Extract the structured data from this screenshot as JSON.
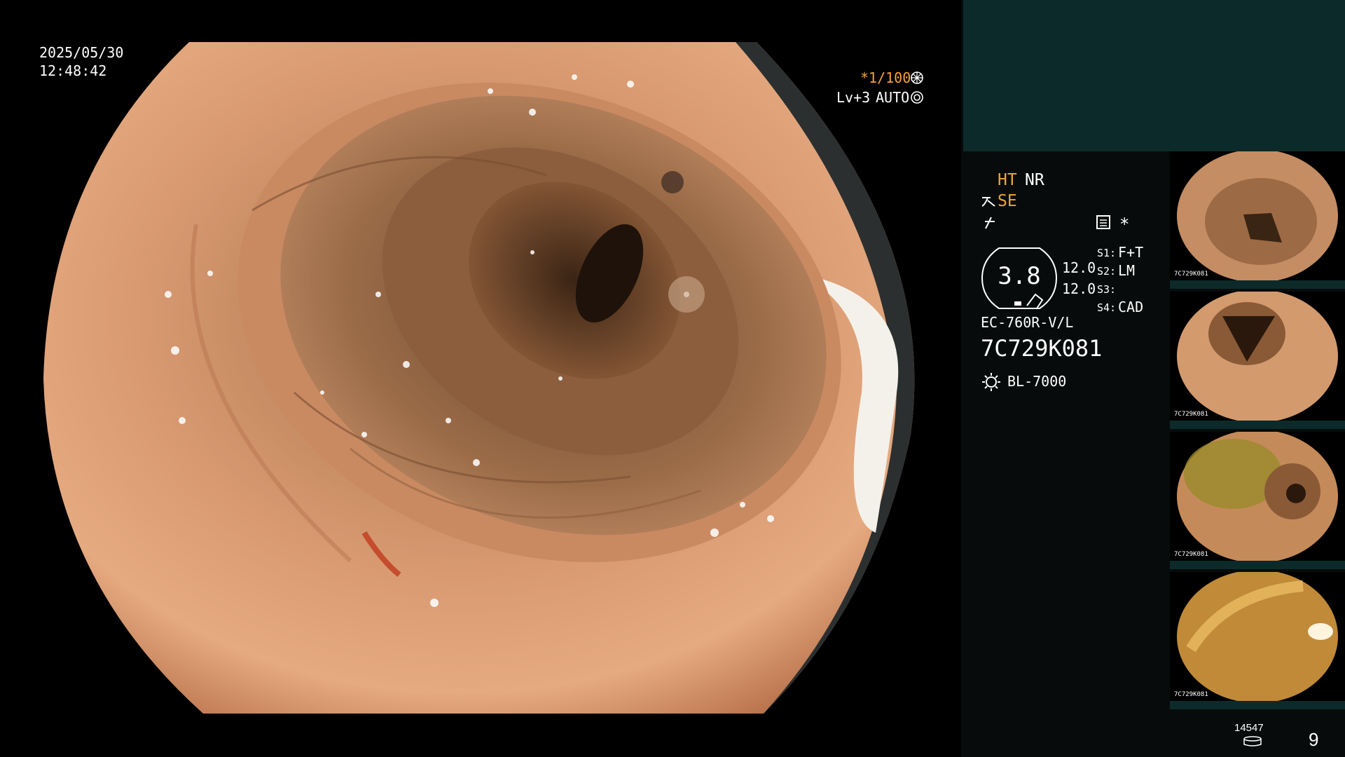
{
  "osd": {
    "date": "2025/05/30",
    "time": "12:48:42",
    "shutter_prefix": "*",
    "shutter": "1/100",
    "iris_level": "Lv+3",
    "iris_mode": "AUTO"
  },
  "status": {
    "ht": "HT",
    "nr": "NR",
    "se": "SE",
    "zoom_value": "3.8",
    "param1": "12.0",
    "param2": "12.0",
    "s1_label": "S1:",
    "s1_value": "F+T",
    "s2_label": "S2:",
    "s2_value": "LM",
    "s3_label": "S3:",
    "s3_value": "",
    "s4_label": "S4:",
    "s4_value": "CAD",
    "asterisk": "*",
    "scope_model": "EC-760R-V/L",
    "scope_serial": "7C729K081",
    "light_source": "BL-7000"
  },
  "thumbnails": [
    {
      "label": "7C729K081"
    },
    {
      "label": "7C729K081"
    },
    {
      "label": "7C729K081"
    },
    {
      "label": "7C729K081"
    }
  ],
  "footer": {
    "image_count": "14547",
    "page": "9"
  },
  "icons": {
    "shutter": "shutter-icon",
    "iris": "iris-icon",
    "enhance": "structure-enhance-icon",
    "freeze": "freeze-icon",
    "light": "light-source-icon",
    "memory": "memory-icon",
    "menu": "menu-icon"
  },
  "colors": {
    "accent_orange": "#f2a33a",
    "panel_teal": "#0d2a2a",
    "panel_dark": "#070b0b"
  }
}
